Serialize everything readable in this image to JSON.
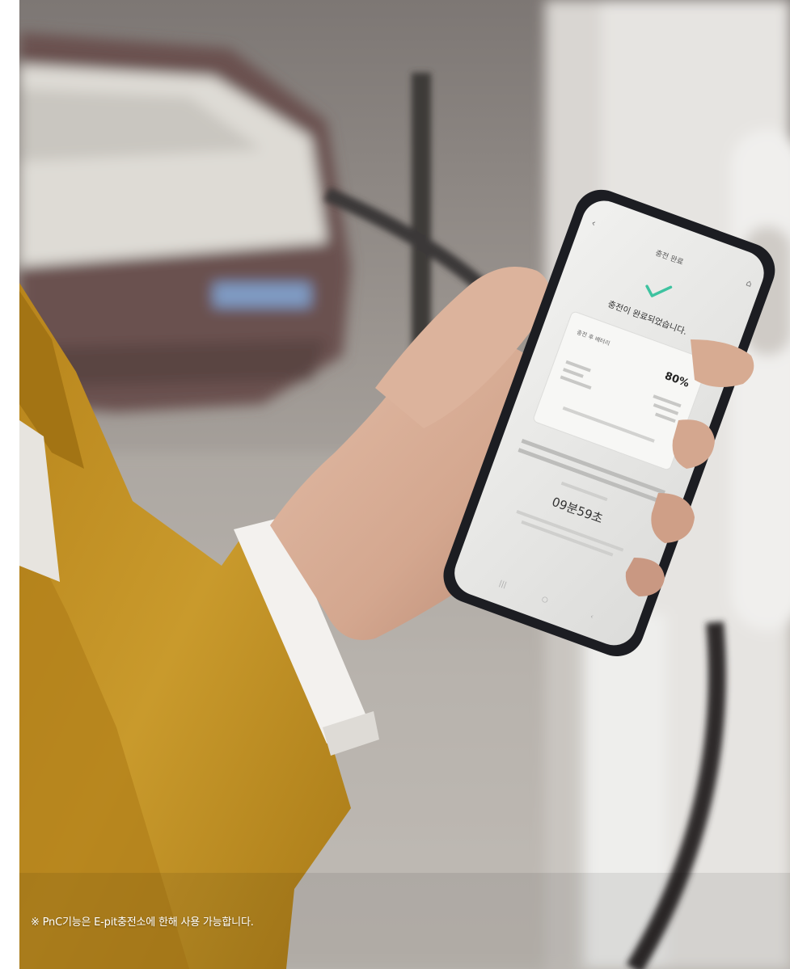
{
  "photo": {
    "subject": "hand-holding-smartphone-ev-charging"
  },
  "phone_screen": {
    "header_title": "충전 완료",
    "check_icon": "check-icon",
    "message": "충전이 완료되었습니다.",
    "battery_label": "충전 후 배터리",
    "battery_value": "80%",
    "timer_value": "09분59초"
  },
  "footnote": "※ PnC기능은 E-pit충전소에 한해 사용 가능합니다.",
  "colors": {
    "accent_check": "#3ec3a0",
    "jacket": "#c79422",
    "phone_body": "#1c1d22"
  }
}
